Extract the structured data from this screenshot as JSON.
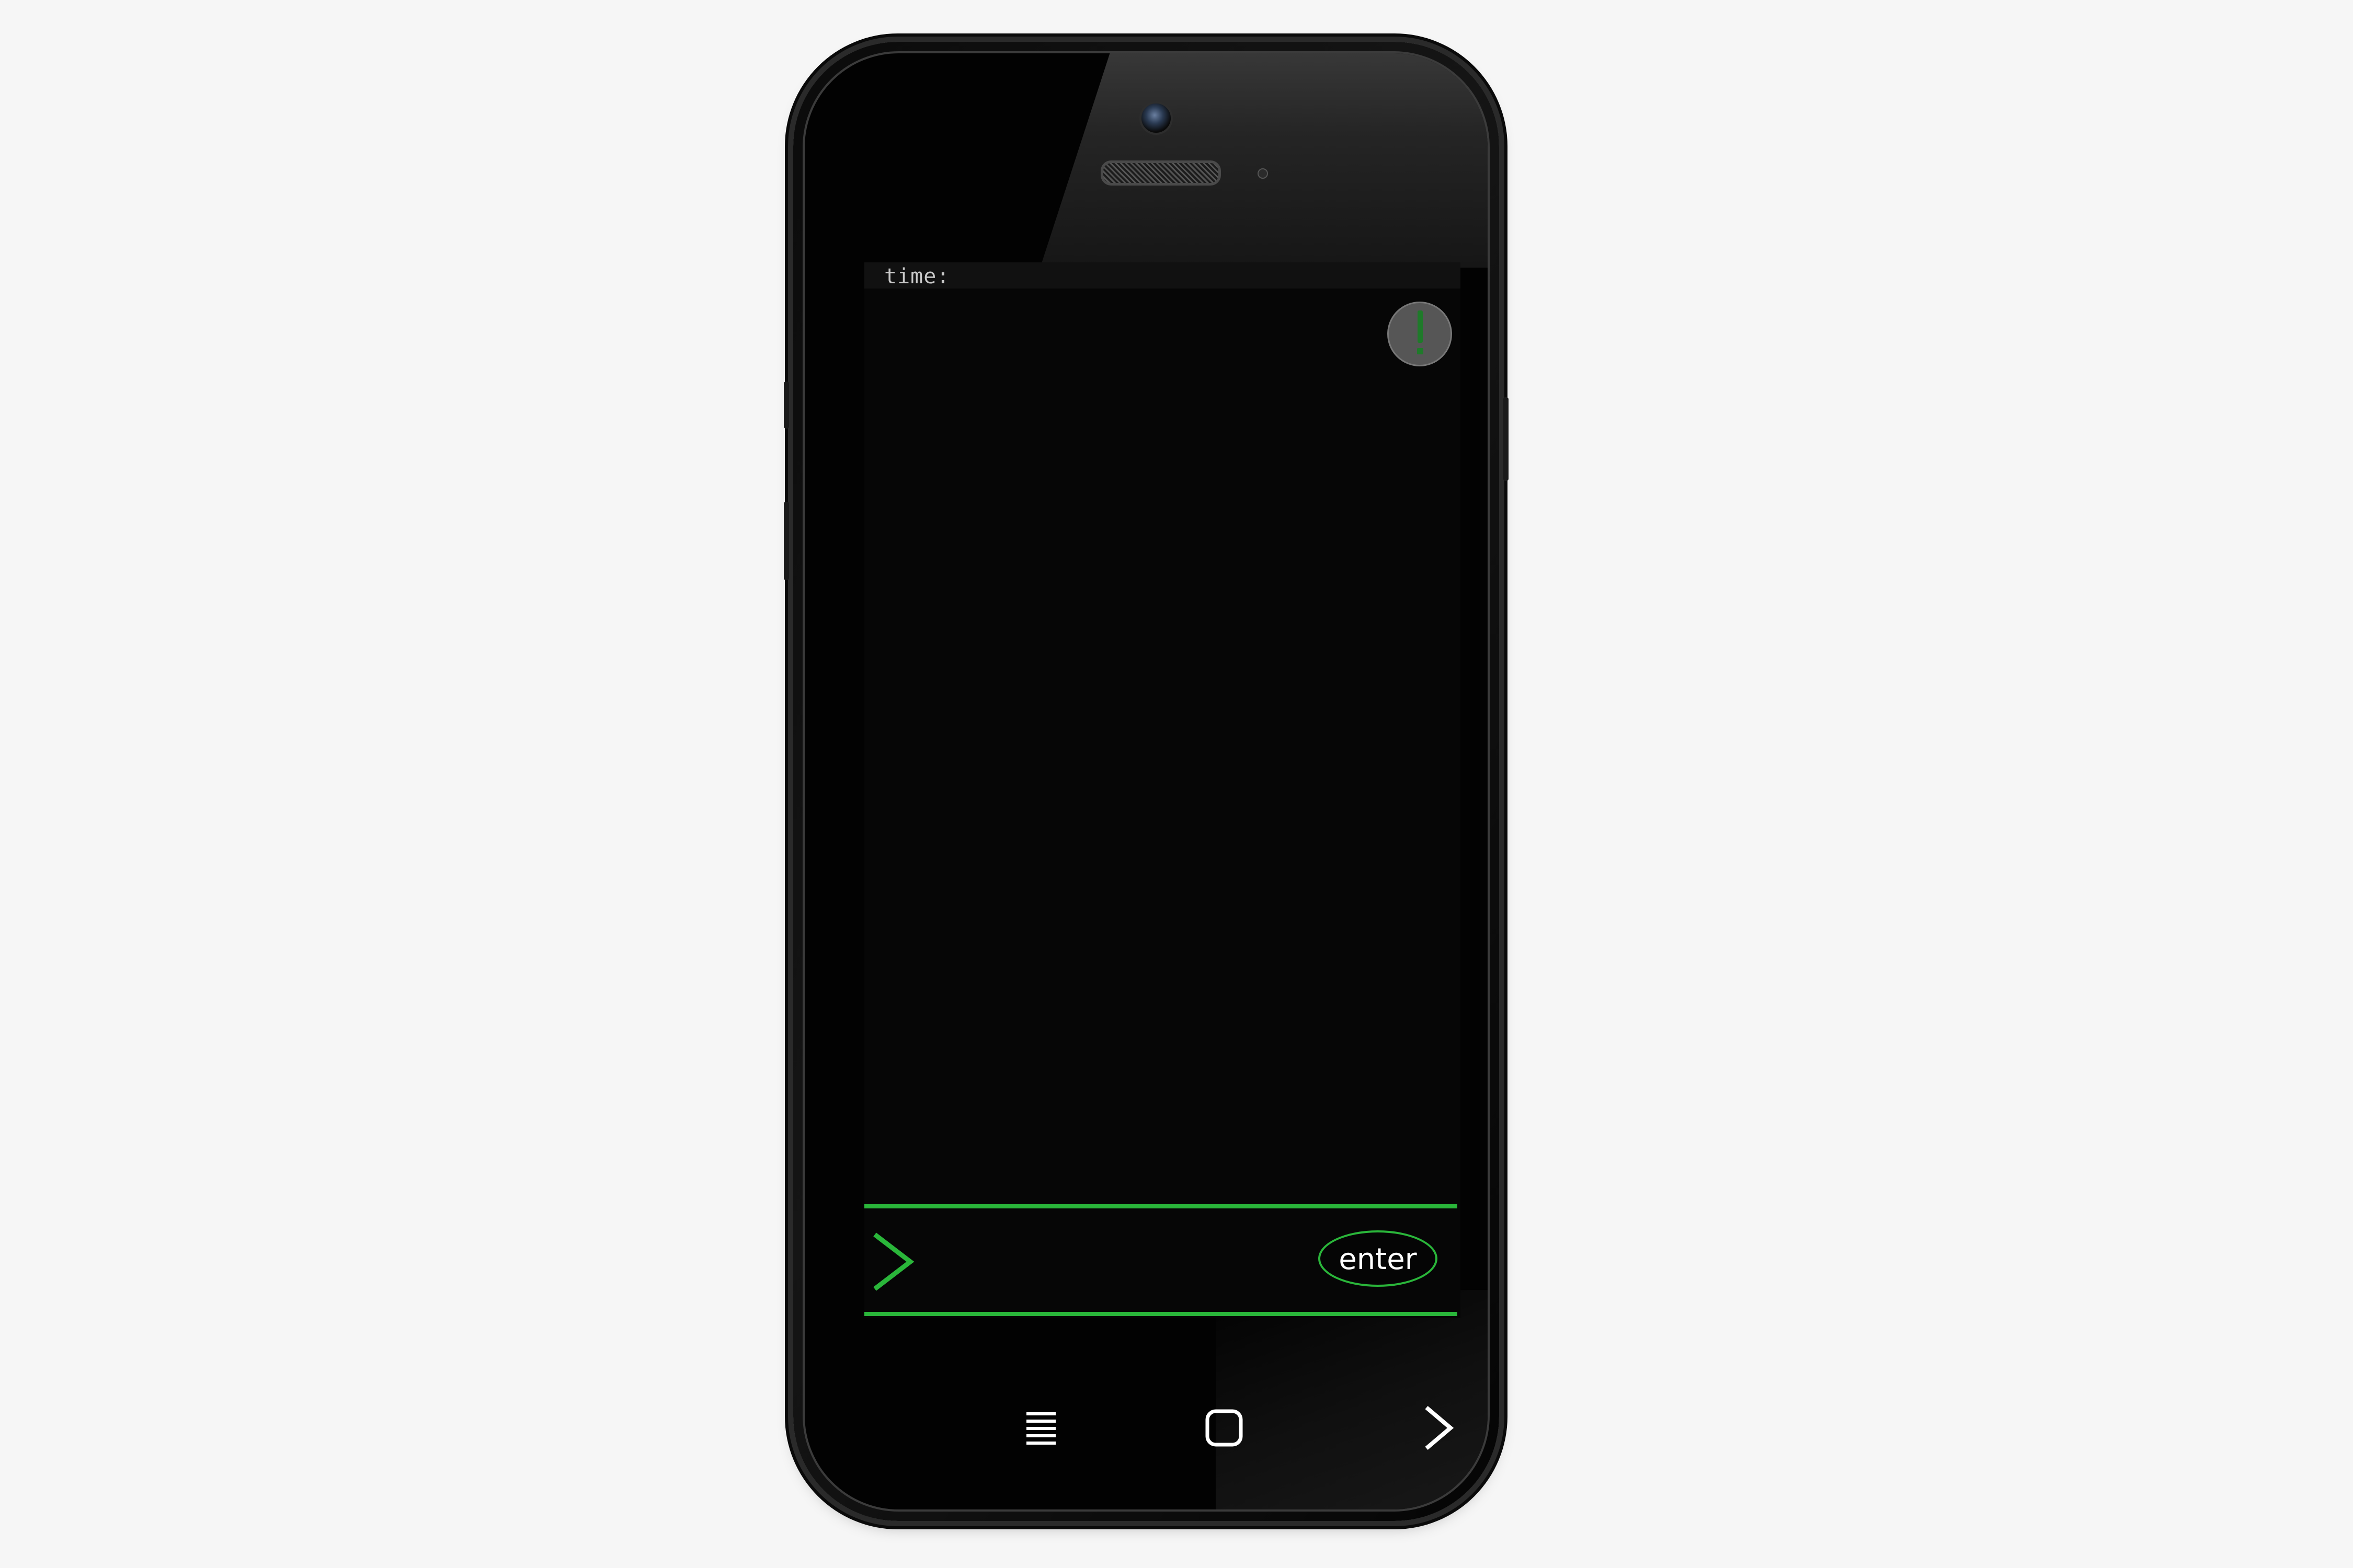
{
  "screen": {
    "status_bar": {
      "time_label": "time:"
    },
    "alert_button": {
      "icon": "exclamation-icon",
      "color": "#1f7a2a"
    },
    "command_bar": {
      "prompt_icon": "chevron-right-icon",
      "input_value": "",
      "input_placeholder": "",
      "enter_label": "enter",
      "accent_color": "#2ab63a"
    }
  },
  "nav_bar": {
    "items": [
      {
        "name": "menu",
        "icon": "menu-lines-icon"
      },
      {
        "name": "home",
        "icon": "rounded-square-icon"
      },
      {
        "name": "forward",
        "icon": "chevron-right-icon"
      }
    ]
  },
  "colors": {
    "background": "#f6f6f6",
    "screen": "#060606",
    "accent_green": "#2ab63a",
    "alert_grey": "#565656"
  }
}
